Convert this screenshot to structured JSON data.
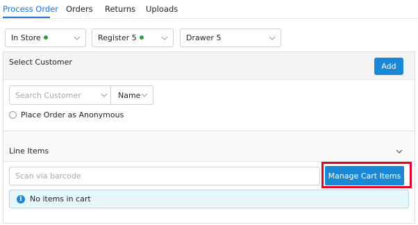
{
  "tabs": [
    {
      "label": "Process Order",
      "active": true
    },
    {
      "label": "Orders",
      "active": false
    },
    {
      "label": "Returns",
      "active": false
    },
    {
      "label": "Uploads",
      "active": false
    }
  ],
  "selectors": {
    "store": {
      "value": "In Store",
      "status_color": "#2e9e3a"
    },
    "register": {
      "value": "Register 5",
      "status_color": "#2e9e3a"
    },
    "drawer": {
      "value": "Drawer 5"
    }
  },
  "customer": {
    "title": "Select Customer",
    "add_label": "Add",
    "search_placeholder": "Search Customer",
    "search_by": "Name",
    "anonymous_label": "Place Order as Anonymous"
  },
  "line_items": {
    "title": "Line Items",
    "barcode_placeholder": "Scan via barcode",
    "manage_label": "Manage Cart Items",
    "empty_message": "No items in cart"
  },
  "colors": {
    "accent": "#1b6fd1",
    "button": "#1b88d6",
    "highlight": "#e5001f",
    "info_bg": "#e6f6fb"
  }
}
